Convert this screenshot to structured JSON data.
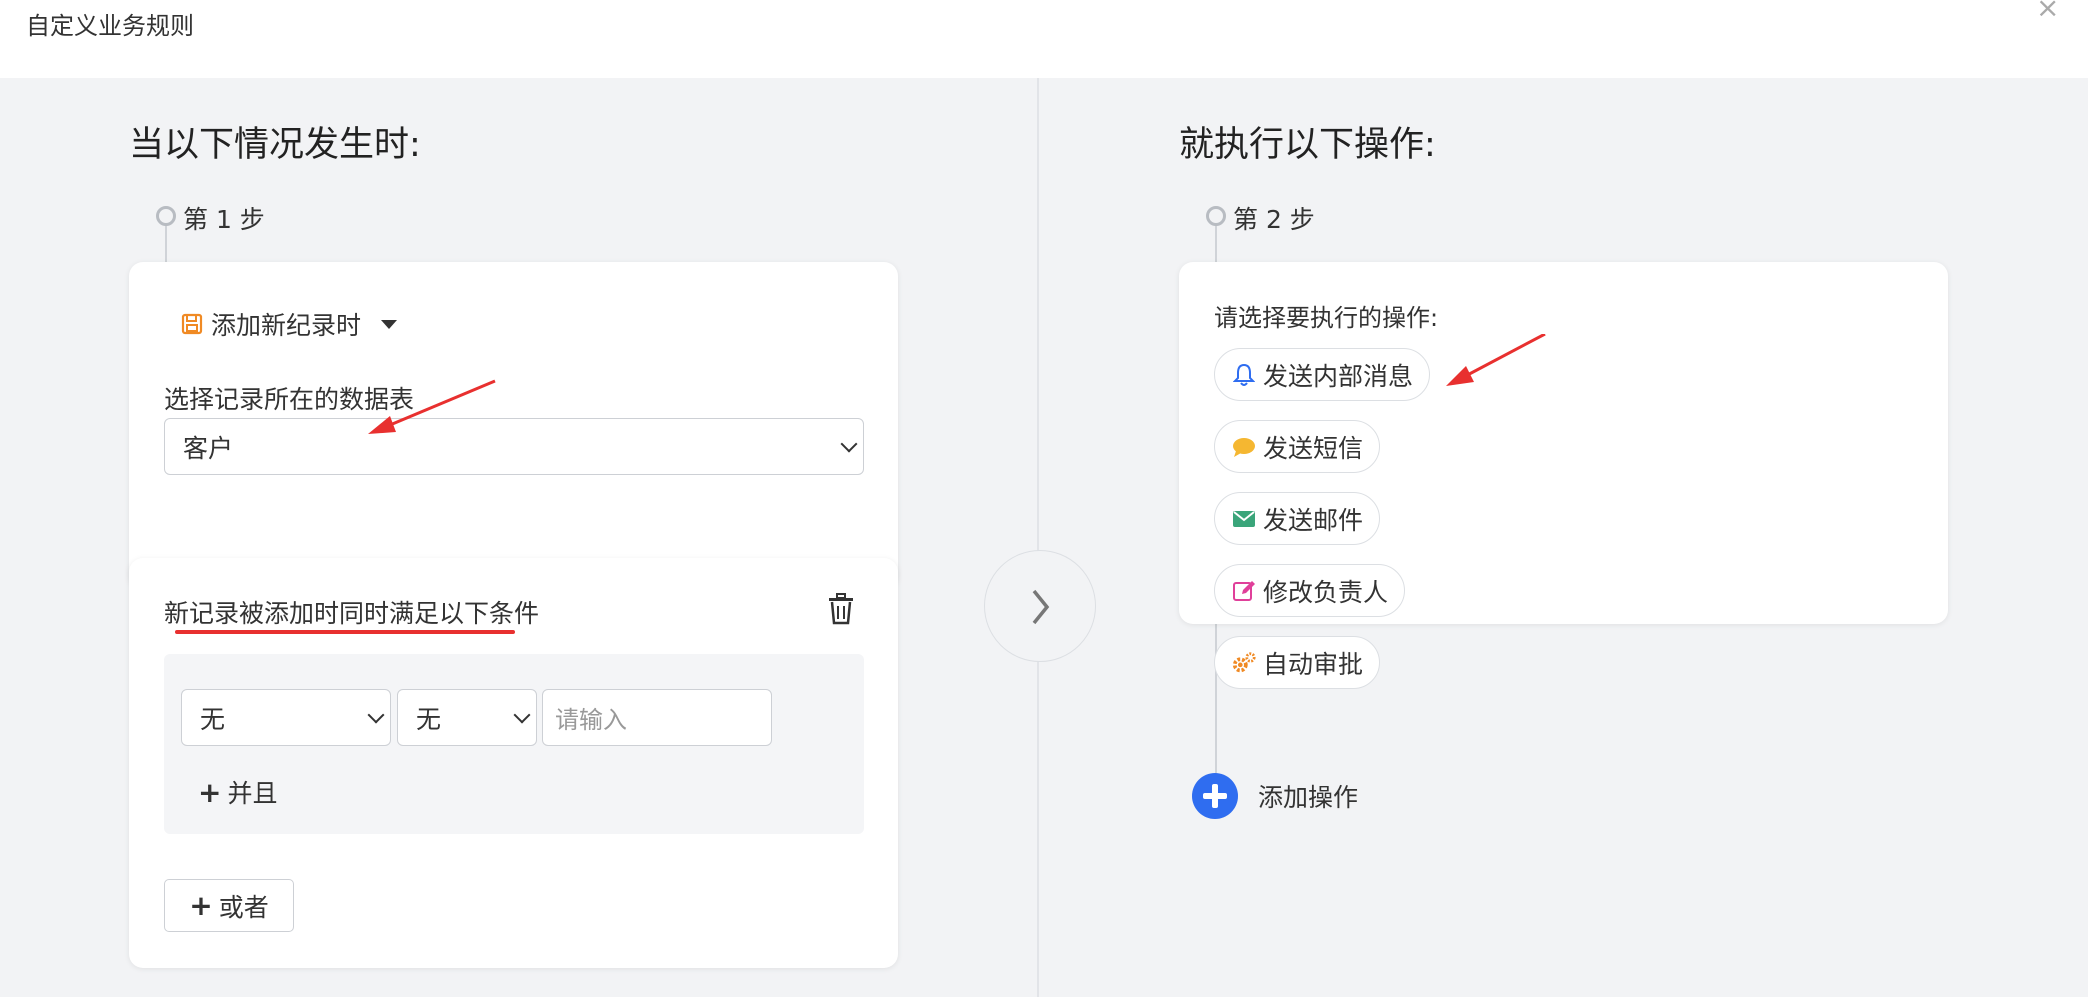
{
  "dialog": {
    "title": "自定义业务规则",
    "close_symbol": "×"
  },
  "left": {
    "section_title": "当以下情况发生时:",
    "step_label": "第 1 步",
    "trigger": {
      "icon": "save-icon",
      "label": "添加新纪录时"
    },
    "table_label": "选择记录所在的数据表",
    "table_value": "客户",
    "condition": {
      "title": "新记录被添加时同时满足以下条件",
      "field_value": "无",
      "operator_value": "无",
      "input_placeholder": "请输入",
      "and_label": "并且",
      "or_label": "或者"
    }
  },
  "right": {
    "section_title": "就执行以下操作:",
    "step_label": "第 2 步",
    "prompt": "请选择要执行的操作:",
    "actions": [
      {
        "label": "发送内部消息",
        "icon": "bell-icon",
        "color": "#2f6df0"
      },
      {
        "label": "发送短信",
        "icon": "chat-bubble-icon",
        "color": "#f5b731"
      },
      {
        "label": "发送邮件",
        "icon": "envelope-icon",
        "color": "#3aa57a"
      },
      {
        "label": "修改负责人",
        "icon": "edit-icon",
        "color": "#e0409a"
      },
      {
        "label": "自动审批",
        "icon": "gears-icon",
        "color": "#f08a24"
      }
    ],
    "add_action_label": "添加操作"
  },
  "colors": {
    "accent": "#2f6df0",
    "annotation": "#e8302f",
    "background": "#f2f3f5"
  }
}
